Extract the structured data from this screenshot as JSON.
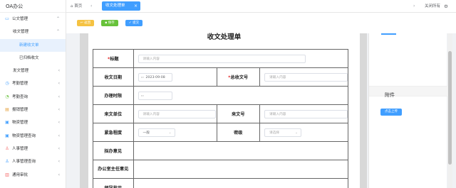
{
  "app": {
    "title": "OA办公"
  },
  "sidebar": {
    "items": [
      {
        "label": "公文管理",
        "icon": "document-icon",
        "arrow": "⌃"
      },
      {
        "label": "收文管理",
        "arrow": "⌃"
      },
      {
        "label": "新建收文单"
      },
      {
        "label": "已归档收文"
      },
      {
        "label": "发文管理",
        "arrow": "‹"
      },
      {
        "label": "考勤管理",
        "icon": "clock-icon",
        "arrow": "‹"
      },
      {
        "label": "考勤查询",
        "icon": "calendar-search-icon",
        "arrow": "‹"
      },
      {
        "label": "报销管理",
        "icon": "receipt-icon",
        "arrow": "‹"
      },
      {
        "label": "物资管理",
        "icon": "box-icon",
        "arrow": "‹"
      },
      {
        "label": "物资管理查询",
        "icon": "box-search-icon",
        "arrow": "‹"
      },
      {
        "label": "人事管理",
        "icon": "person-icon",
        "arrow": "‹"
      },
      {
        "label": "人事管理查询",
        "icon": "person-search-icon",
        "arrow": "‹"
      },
      {
        "label": "通用审批",
        "icon": "approval-icon",
        "arrow": "‹"
      }
    ]
  },
  "tabs": {
    "home": "首页",
    "active": "收文处理单",
    "close_all": "关闭所有"
  },
  "toolbar": {
    "btn1": "返回",
    "btn2": "保存",
    "btn3": "提交"
  },
  "form": {
    "title": "收文处理单",
    "labels": {
      "subject": "标题",
      "receive_date": "收文日期",
      "total_no": "总收文号",
      "deadline": "办理时限",
      "source_unit": "来文单位",
      "source_no": "来文号",
      "urgency": "紧急程度",
      "secret_level": "密级",
      "draft_opinion": "拟办意见",
      "director_opinion": "办公室主任意见",
      "leader_instruction": "领导批示"
    },
    "values": {
      "receive_date": "2023-09-08",
      "urgency": "一般"
    },
    "placeholders": {
      "text": "请输入内容",
      "select": "请选择"
    }
  },
  "right_panel": {
    "attachment_title": "附件",
    "upload_label": "点击上传"
  }
}
